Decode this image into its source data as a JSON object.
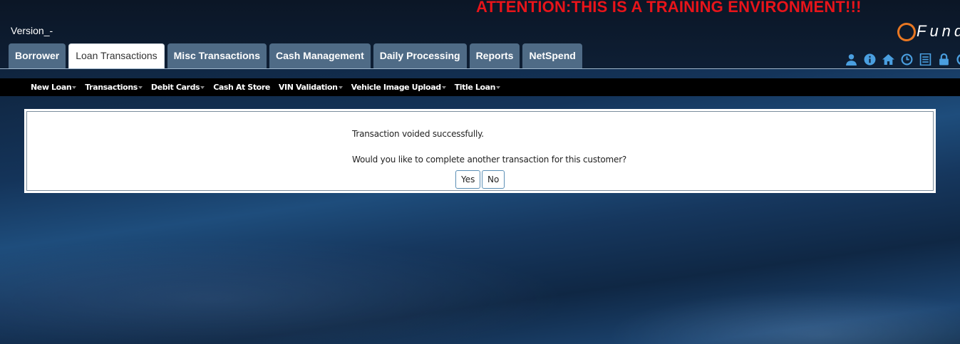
{
  "banner": {
    "text": "ATTENTION:THIS IS A TRAINING ENVIRONMENT!!!"
  },
  "header": {
    "version": "Version_-",
    "logo_text": "Fund"
  },
  "tabs": [
    {
      "label": "Borrower",
      "active": false
    },
    {
      "label": "Loan Transactions",
      "active": true
    },
    {
      "label": "Misc Transactions",
      "active": false
    },
    {
      "label": "Cash Management",
      "active": false
    },
    {
      "label": "Daily Processing",
      "active": false
    },
    {
      "label": "Reports",
      "active": false
    },
    {
      "label": "NetSpend",
      "active": false
    }
  ],
  "toolbar_icons": [
    "user-icon",
    "info-icon",
    "home-icon",
    "clock-icon",
    "list-icon",
    "lock-icon",
    "settings-icon"
  ],
  "subnav": {
    "items": [
      {
        "label": "New Loan"
      },
      {
        "label": "Transactions"
      },
      {
        "label": "Debit Cards"
      },
      {
        "label": "Cash At Store"
      },
      {
        "label": "VIN Validation"
      },
      {
        "label": "Vehicle Image Upload"
      },
      {
        "label": "Title Loan"
      }
    ]
  },
  "dialog": {
    "message": "Transaction voided successfully.",
    "question": "Would you like to complete another transaction for this customer?",
    "yes_label": "Yes",
    "no_label": "No"
  },
  "colors": {
    "banner": "#e8141a",
    "tab": "#4f6b86",
    "logo_accent": "#e87722",
    "icon": "#4a9fe0"
  }
}
